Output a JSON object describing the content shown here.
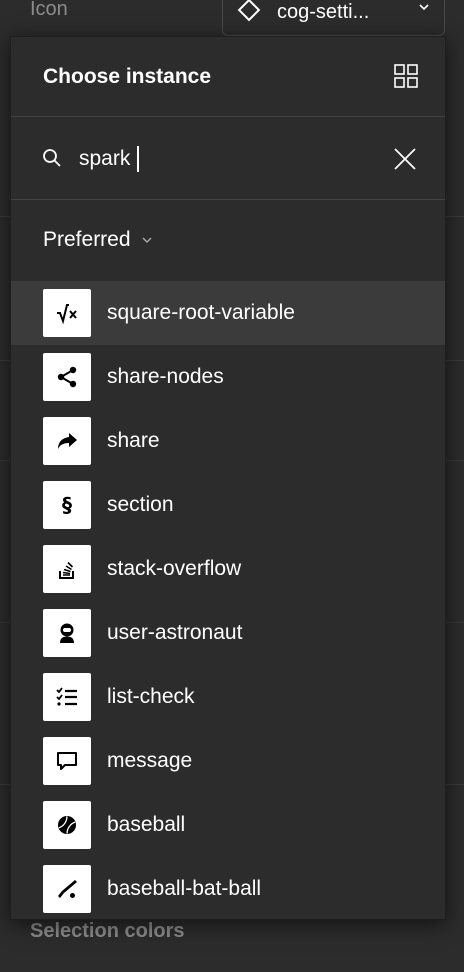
{
  "background": {
    "icon_label": "Icon",
    "instance_select_value": "cog-setti...",
    "section_label": "Selection colors"
  },
  "popup": {
    "title": "Choose instance",
    "search": {
      "value": "spark"
    },
    "filter_label": "Preferred",
    "items": [
      {
        "label": "square-root-variable",
        "icon": "square-root-variable-icon",
        "active": true
      },
      {
        "label": "share-nodes",
        "icon": "share-nodes-icon"
      },
      {
        "label": "share",
        "icon": "share-icon"
      },
      {
        "label": "section",
        "icon": "section-icon"
      },
      {
        "label": "stack-overflow",
        "icon": "stack-overflow-icon"
      },
      {
        "label": "user-astronaut",
        "icon": "user-astronaut-icon"
      },
      {
        "label": "list-check",
        "icon": "list-check-icon"
      },
      {
        "label": "message",
        "icon": "message-icon"
      },
      {
        "label": "baseball",
        "icon": "baseball-icon"
      },
      {
        "label": "baseball-bat-ball",
        "icon": "baseball-bat-ball-icon"
      }
    ]
  },
  "colors": {
    "panel_bg": "#2c2c2c",
    "active_row": "#3b3b3b",
    "divider": "#444444",
    "muted_text": "#8c8c8c"
  }
}
